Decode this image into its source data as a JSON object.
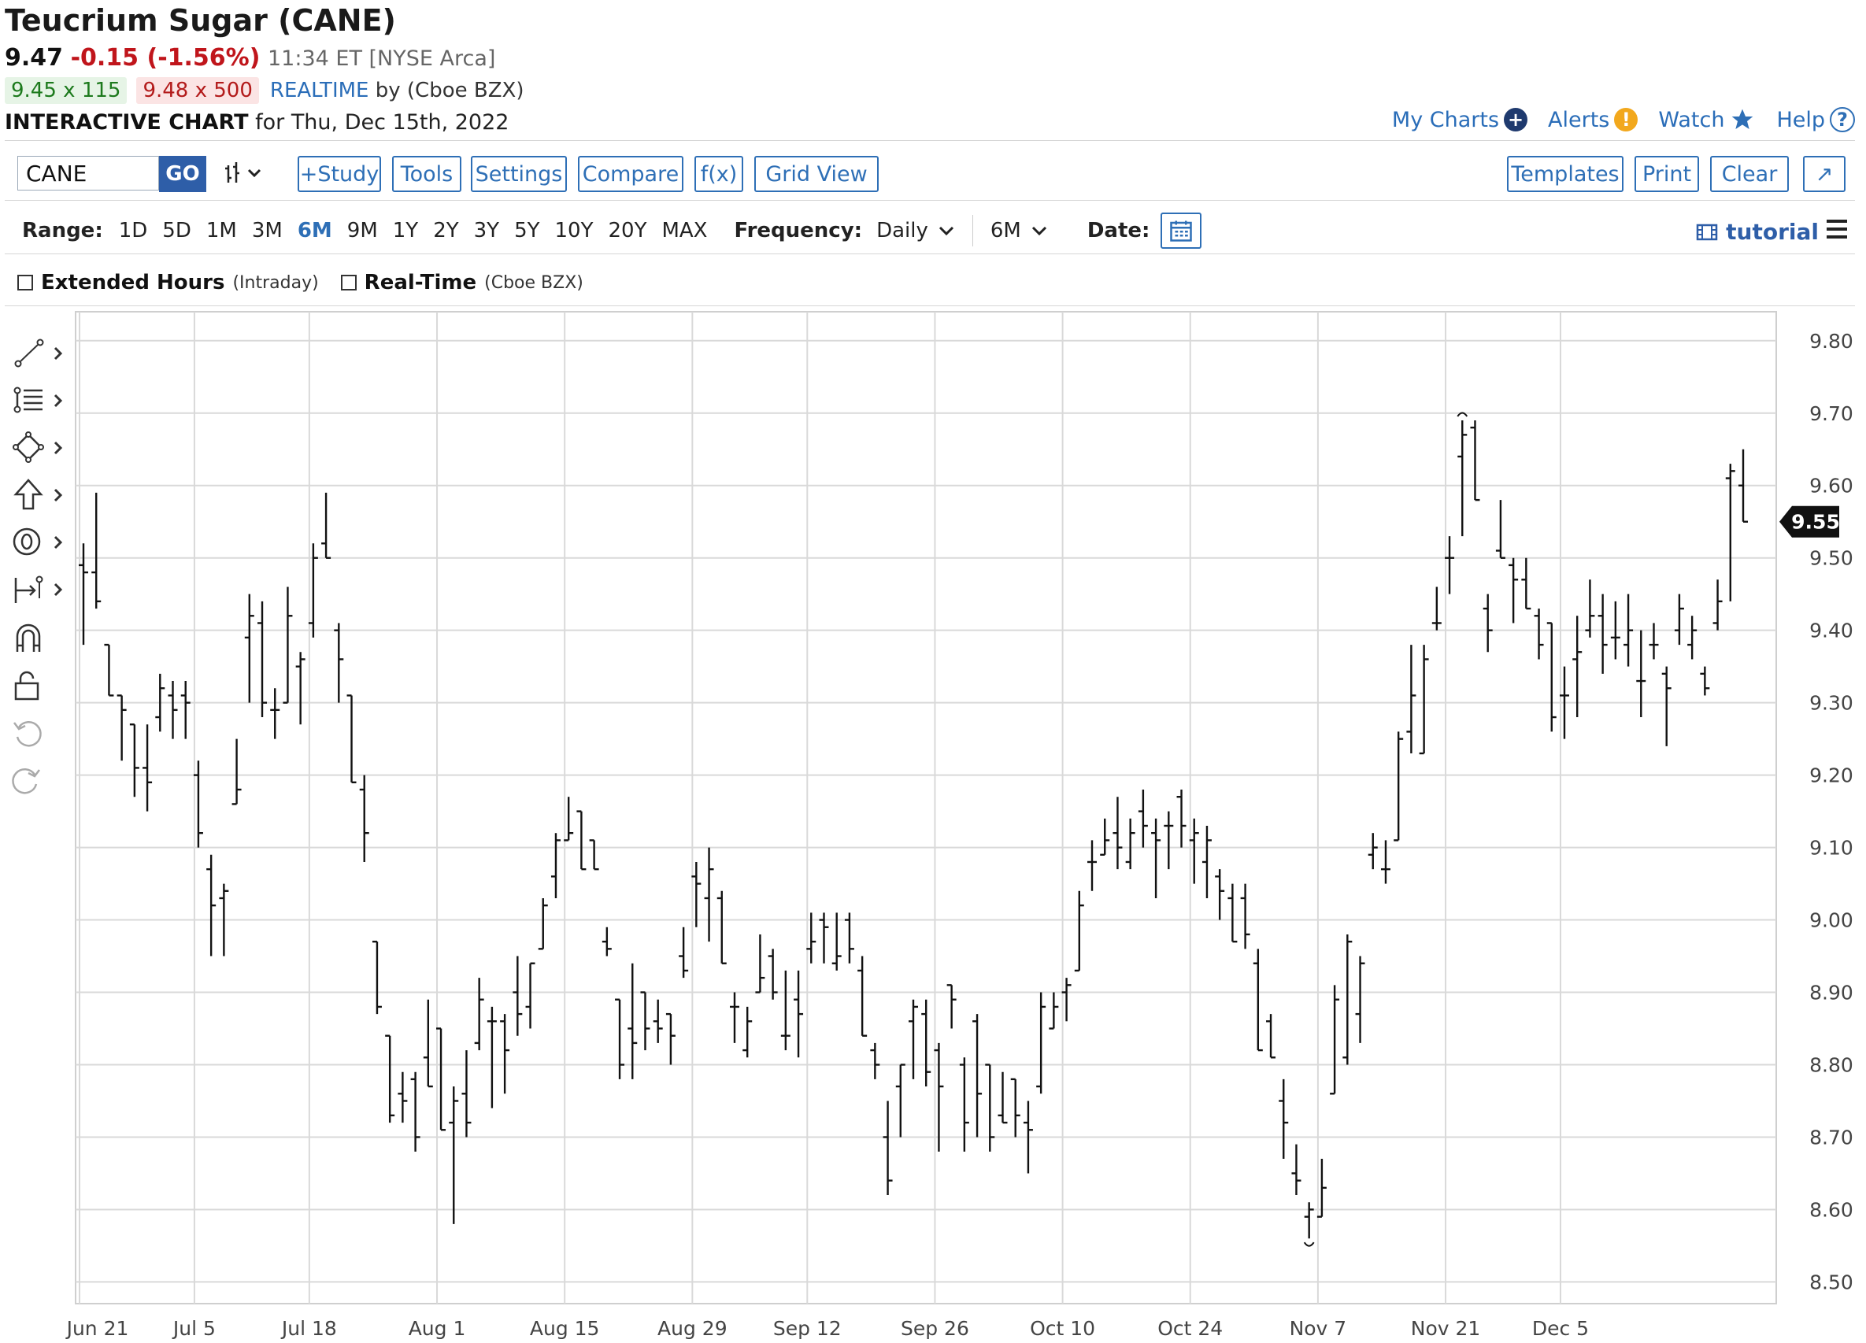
{
  "header": {
    "title": "Teucrium Sugar (CANE)",
    "last": "9.47",
    "change": "-0.15 (-1.56%)",
    "time": "11:34 ET [NYSE Arca]",
    "bid": "9.45 x 115",
    "ask": "9.48 x 500",
    "realtime_label": "REALTIME",
    "realtime_by": "by (Cboe BZX)",
    "chart_label": "INTERACTIVE CHART",
    "chart_date": "for Thu, Dec 15th, 2022"
  },
  "top_links": {
    "my_charts": "My Charts",
    "alerts": "Alerts",
    "watch": "Watch",
    "help": "Help"
  },
  "toolbar": {
    "symbol": "CANE",
    "go": "GO",
    "study": "+Study",
    "tools": "Tools",
    "settings": "Settings",
    "compare": "Compare",
    "fx": "f(x)",
    "grid_view": "Grid View",
    "templates": "Templates",
    "print": "Print",
    "clear": "Clear",
    "expand": "↗"
  },
  "range": {
    "label": "Range:",
    "options": [
      "1D",
      "5D",
      "1M",
      "3M",
      "6M",
      "9M",
      "1Y",
      "2Y",
      "3Y",
      "5Y",
      "10Y",
      "20Y",
      "MAX"
    ],
    "active": "6M",
    "frequency_label": "Frequency:",
    "frequency": "Daily",
    "period": "6M",
    "date_label": "Date:",
    "tutorial": "tutorial"
  },
  "options": {
    "extended_hours": "Extended Hours",
    "extended_hours_note": "(Intraday)",
    "realtime": "Real-Time",
    "realtime_note": "(Cboe BZX)"
  },
  "left_tools": [
    "line-tool-icon",
    "fibonacci-tool-icon",
    "shape-tool-icon",
    "arrow-tool-icon",
    "annotation-tool-icon",
    "measure-tool-icon",
    "magnet-icon",
    "lock-icon",
    "undo-icon",
    "redo-icon"
  ],
  "chart_data": {
    "type": "ohlc",
    "ylim": [
      8.47,
      9.84
    ],
    "yticks": [
      9.8,
      9.7,
      9.6,
      9.5,
      9.4,
      9.3,
      9.2,
      9.1,
      9.0,
      8.9,
      8.8,
      8.7,
      8.6,
      8.5
    ],
    "ytick_labels": [
      "9.80",
      "9.70",
      "9.60",
      "9.50",
      "9.40",
      "9.30",
      "9.20",
      "9.10",
      "9.00",
      "8.90",
      "8.80",
      "8.70",
      "8.60",
      "8.50"
    ],
    "x_labels": [
      "Jun 21",
      "Jul 5",
      "Jul 18",
      "Aug 1",
      "Aug 15",
      "Aug 29",
      "Sep 12",
      "Sep 26",
      "Oct 10",
      "Oct 24",
      "Nov 7",
      "Nov 21",
      "Dec 5"
    ],
    "x_label_index": [
      0,
      9,
      18,
      28,
      38,
      48,
      57,
      67,
      77,
      87,
      97,
      107,
      116
    ],
    "last_price_label": "9.55",
    "last_price": 9.55,
    "bars": [
      [
        9.49,
        9.52,
        9.38,
        9.48
      ],
      [
        9.48,
        9.59,
        9.43,
        9.44
      ],
      [
        9.38,
        9.38,
        9.31,
        9.31
      ],
      [
        9.31,
        9.31,
        9.22,
        9.29
      ],
      [
        9.27,
        9.27,
        9.17,
        9.21
      ],
      [
        9.21,
        9.27,
        9.15,
        9.19
      ],
      [
        9.28,
        9.34,
        9.26,
        9.32
      ],
      [
        9.31,
        9.33,
        9.25,
        9.29
      ],
      [
        9.31,
        9.33,
        9.25,
        9.3
      ],
      [
        9.2,
        9.22,
        9.1,
        9.12
      ],
      [
        9.07,
        9.09,
        8.95,
        9.02
      ],
      [
        9.03,
        9.05,
        8.95,
        9.04
      ],
      [
        9.16,
        9.25,
        9.16,
        9.18
      ],
      [
        9.39,
        9.45,
        9.3,
        9.42
      ],
      [
        9.41,
        9.44,
        9.28,
        9.3
      ],
      [
        9.29,
        9.32,
        9.25,
        9.29
      ],
      [
        9.3,
        9.46,
        9.3,
        9.42
      ],
      [
        9.35,
        9.37,
        9.27,
        9.36
      ],
      [
        9.41,
        9.52,
        9.39,
        9.5
      ],
      [
        9.52,
        9.59,
        9.5,
        9.5
      ],
      [
        9.4,
        9.41,
        9.3,
        9.36
      ],
      [
        9.31,
        9.31,
        9.19,
        9.19
      ],
      [
        9.18,
        9.2,
        9.08,
        9.12
      ],
      [
        8.97,
        8.97,
        8.87,
        8.88
      ],
      [
        8.84,
        8.84,
        8.72,
        8.73
      ],
      [
        8.76,
        8.79,
        8.72,
        8.75
      ],
      [
        8.78,
        8.79,
        8.68,
        8.7
      ],
      [
        8.81,
        8.89,
        8.77,
        8.77
      ],
      [
        8.85,
        8.85,
        8.71,
        8.71
      ],
      [
        8.72,
        8.77,
        8.58,
        8.75
      ],
      [
        8.76,
        8.82,
        8.7,
        8.72
      ],
      [
        8.83,
        8.92,
        8.82,
        8.89
      ],
      [
        8.86,
        8.88,
        8.74,
        8.86
      ],
      [
        8.86,
        8.87,
        8.76,
        8.82
      ],
      [
        8.9,
        8.95,
        8.84,
        8.87
      ],
      [
        8.88,
        8.94,
        8.85,
        8.94
      ],
      [
        8.96,
        9.03,
        8.96,
        9.02
      ],
      [
        9.06,
        9.12,
        9.03,
        9.11
      ],
      [
        9.11,
        9.17,
        9.12,
        9.12
      ],
      [
        9.15,
        9.14,
        9.07,
        9.07
      ],
      [
        9.11,
        9.1,
        9.08,
        9.07
      ],
      [
        8.97,
        8.99,
        8.95,
        8.96
      ],
      [
        8.89,
        8.89,
        8.78,
        8.8
      ],
      [
        8.85,
        8.94,
        8.78,
        8.83
      ],
      [
        8.9,
        8.9,
        8.82,
        8.85
      ],
      [
        8.86,
        8.89,
        8.83,
        8.85
      ],
      [
        8.87,
        8.84,
        8.8,
        8.84
      ],
      [
        8.95,
        8.99,
        8.92,
        8.93
      ],
      [
        9.06,
        9.08,
        8.99,
        9.05
      ],
      [
        9.03,
        9.1,
        8.97,
        9.07
      ],
      [
        9.03,
        9.04,
        8.94,
        8.94
      ],
      [
        8.88,
        8.9,
        8.83,
        8.88
      ],
      [
        8.82,
        8.88,
        8.81,
        8.86
      ],
      [
        8.9,
        8.98,
        8.9,
        8.92
      ],
      [
        8.95,
        8.96,
        8.89,
        8.9
      ],
      [
        8.84,
        8.93,
        8.82,
        8.84
      ],
      [
        8.89,
        8.93,
        8.81,
        8.87
      ],
      [
        8.96,
        9.01,
        8.94,
        8.97
      ],
      [
        9.0,
        9.01,
        8.94,
        8.99
      ],
      [
        8.94,
        9.01,
        8.93,
        8.95
      ],
      [
        9.0,
        9.01,
        8.94,
        8.96
      ],
      [
        8.93,
        8.95,
        8.84,
        8.84
      ],
      [
        8.82,
        8.83,
        8.78,
        8.8
      ],
      [
        8.7,
        8.75,
        8.62,
        8.64
      ],
      [
        8.77,
        8.78,
        8.7,
        8.8
      ],
      [
        8.86,
        8.89,
        8.78,
        8.88
      ],
      [
        8.87,
        8.89,
        8.77,
        8.79
      ],
      [
        8.82,
        8.83,
        8.68,
        8.77
      ],
      [
        8.91,
        8.9,
        8.85,
        8.89
      ],
      [
        8.8,
        8.81,
        8.68,
        8.72
      ],
      [
        8.86,
        8.87,
        8.7,
        8.76
      ],
      [
        8.8,
        8.8,
        8.68,
        8.7
      ],
      [
        8.73,
        8.79,
        8.72,
        8.72
      ],
      [
        8.78,
        8.76,
        8.7,
        8.73
      ],
      [
        8.72,
        8.75,
        8.65,
        8.71
      ],
      [
        8.77,
        8.9,
        8.76,
        8.88
      ],
      [
        8.85,
        8.9,
        8.86,
        8.88
      ],
      [
        8.9,
        8.92,
        8.86,
        8.91
      ],
      [
        8.93,
        9.04,
        8.93,
        9.02
      ],
      [
        9.08,
        9.11,
        9.04,
        9.08
      ],
      [
        9.09,
        9.14,
        9.09,
        9.11
      ],
      [
        9.12,
        9.17,
        9.07,
        9.1
      ],
      [
        9.08,
        9.14,
        9.07,
        9.12
      ],
      [
        9.15,
        9.18,
        9.1,
        9.13
      ],
      [
        9.12,
        9.14,
        9.03,
        9.11
      ],
      [
        9.13,
        9.15,
        9.07,
        9.13
      ],
      [
        9.17,
        9.18,
        9.1,
        9.13
      ],
      [
        9.11,
        9.14,
        9.05,
        9.12
      ],
      [
        9.08,
        9.13,
        9.03,
        9.11
      ],
      [
        9.06,
        9.07,
        9.0,
        9.04
      ],
      [
        9.03,
        9.05,
        8.97,
        8.97
      ],
      [
        9.03,
        9.05,
        8.96,
        8.98
      ],
      [
        8.94,
        8.96,
        8.82,
        8.82
      ],
      [
        8.86,
        8.87,
        8.81,
        8.81
      ],
      [
        8.75,
        8.78,
        8.67,
        8.72
      ],
      [
        8.65,
        8.69,
        8.62,
        8.64
      ],
      [
        8.59,
        8.61,
        8.56,
        8.6
      ],
      [
        8.59,
        8.67,
        8.6,
        8.63
      ],
      [
        8.76,
        8.91,
        8.76,
        8.89
      ],
      [
        8.81,
        8.98,
        8.8,
        8.97
      ],
      [
        8.87,
        8.95,
        8.83,
        8.94
      ],
      [
        9.09,
        9.12,
        9.07,
        9.1
      ],
      [
        9.07,
        9.11,
        9.05,
        9.07
      ],
      [
        9.11,
        9.26,
        9.11,
        9.25
      ],
      [
        9.26,
        9.38,
        9.23,
        9.31
      ],
      [
        9.23,
        9.38,
        9.23,
        9.36
      ],
      [
        9.41,
        9.46,
        9.4,
        9.41
      ],
      [
        9.5,
        9.53,
        9.45,
        9.5
      ],
      [
        9.64,
        9.69,
        9.53,
        9.67
      ],
      [
        9.68,
        9.69,
        9.58,
        9.58
      ],
      [
        9.43,
        9.45,
        9.37,
        9.4
      ],
      [
        9.51,
        9.58,
        9.5,
        9.5
      ],
      [
        9.49,
        9.5,
        9.41,
        9.47
      ],
      [
        9.47,
        9.5,
        9.43,
        9.43
      ],
      [
        9.42,
        9.43,
        9.36,
        9.38
      ],
      [
        9.41,
        9.41,
        9.26,
        9.28
      ],
      [
        9.31,
        9.35,
        9.25,
        9.31
      ],
      [
        9.36,
        9.42,
        9.28,
        9.37
      ],
      [
        9.4,
        9.47,
        9.39,
        9.42
      ],
      [
        9.42,
        9.45,
        9.34,
        9.38
      ],
      [
        9.39,
        9.44,
        9.36,
        9.39
      ],
      [
        9.38,
        9.45,
        9.35,
        9.4
      ],
      [
        9.33,
        9.4,
        9.28,
        9.33
      ],
      [
        9.38,
        9.41,
        9.36,
        9.38
      ],
      [
        9.34,
        9.35,
        9.24,
        9.32
      ],
      [
        9.4,
        9.45,
        9.38,
        9.43
      ],
      [
        9.38,
        9.42,
        9.36,
        9.4
      ],
      [
        9.34,
        9.35,
        9.31,
        9.32
      ],
      [
        9.41,
        9.47,
        9.4,
        9.44
      ],
      [
        9.61,
        9.63,
        9.44,
        9.62
      ],
      [
        9.6,
        9.65,
        9.55,
        9.55
      ]
    ]
  }
}
